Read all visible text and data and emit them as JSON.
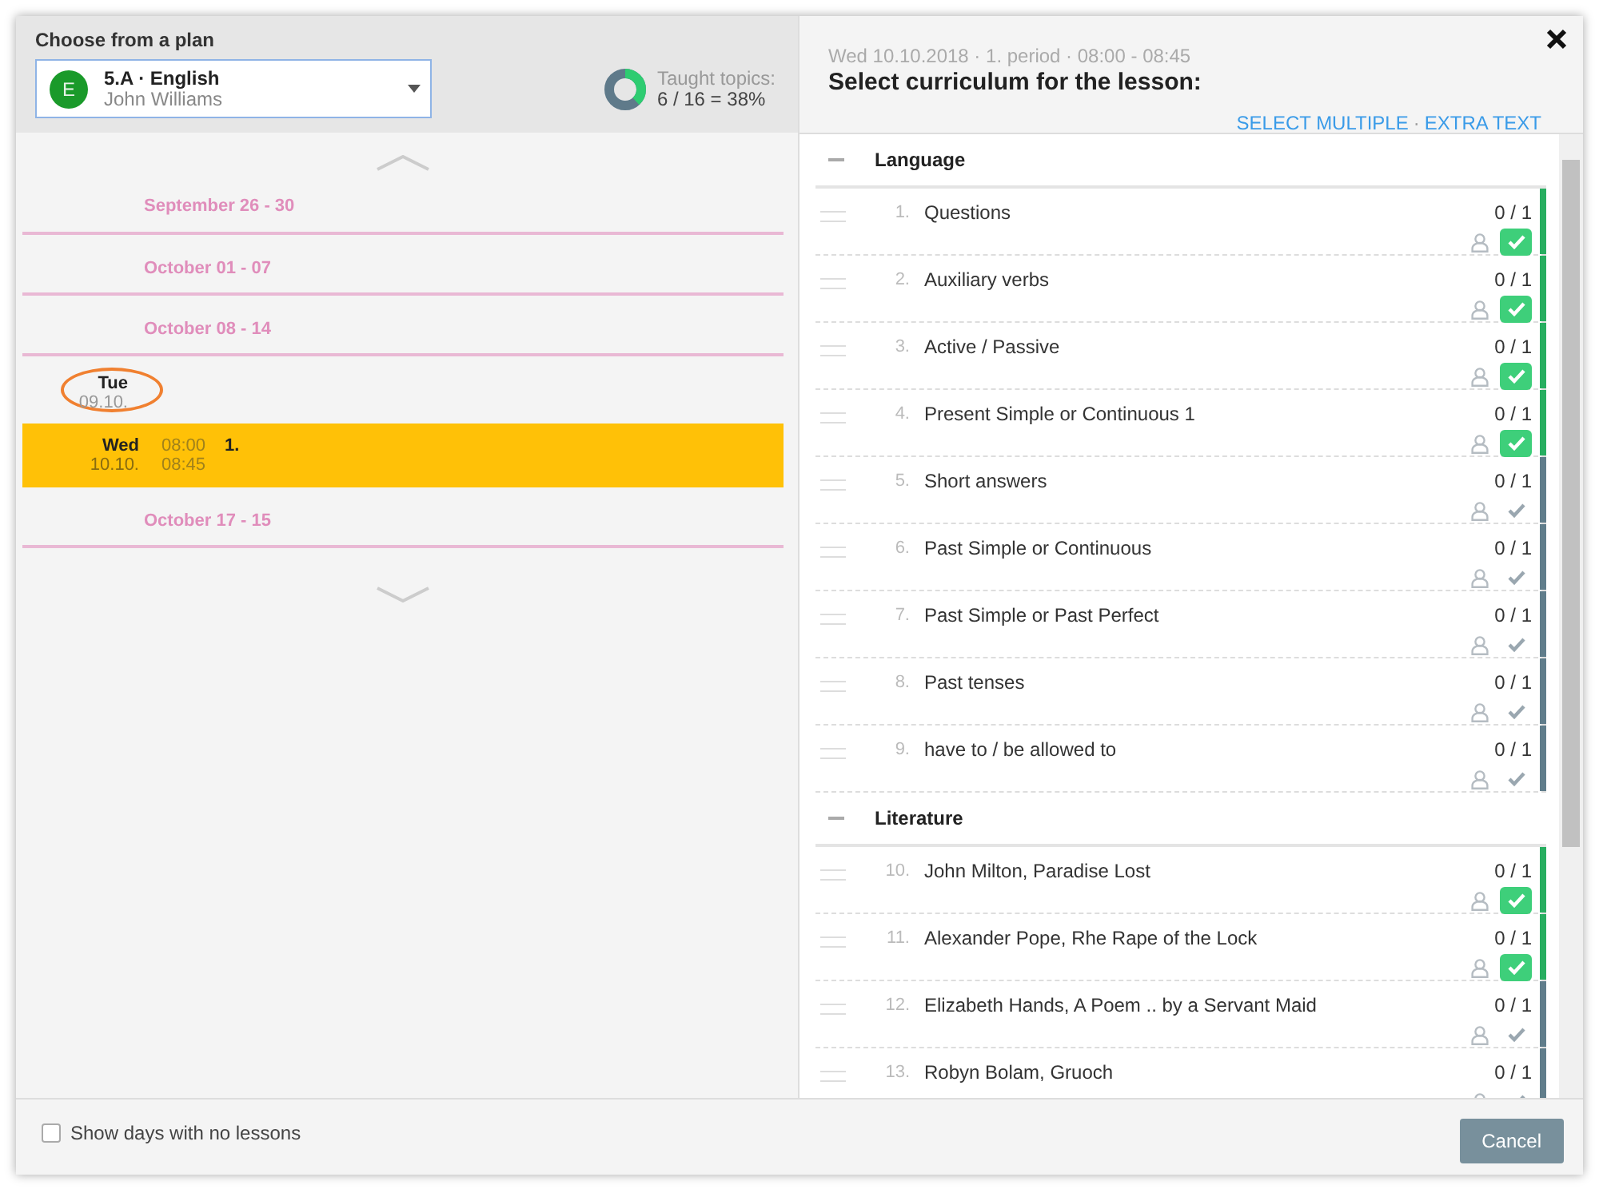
{
  "plan": {
    "heading": "Choose from a plan",
    "badge": "E",
    "title": "5.A · English",
    "teacher": "John Williams"
  },
  "taught": {
    "label": "Taught topics:",
    "value": "6 / 16 = 38%",
    "level": 0.38
  },
  "calendar": [
    {
      "kind": "week",
      "label": "September 26 - 30"
    },
    {
      "kind": "week",
      "label": "October 01 - 07"
    },
    {
      "kind": "week",
      "label": "October 08 - 14"
    },
    {
      "kind": "day",
      "day": "Tue",
      "date": "09.10.",
      "circled": true
    },
    {
      "kind": "lesson",
      "day": "Wed",
      "date": "10.10.",
      "start": "08:00",
      "end": "08:45",
      "period": "1.",
      "selected": true
    },
    {
      "kind": "week",
      "label": "October 17 - 15"
    }
  ],
  "lesson": {
    "subtitle": "Wed 10.10.2018 · 1. period · 08:00 - 08:45",
    "title": "Select curriculum for the lesson:"
  },
  "links": {
    "items": [
      "SELECT MULTIPLE",
      "EXTRA TEXT"
    ],
    "separator": "·"
  },
  "sections": [
    {
      "title": "Language",
      "expanded": true,
      "topics": [
        {
          "number": "1.",
          "name": "Questions",
          "count": "0 / 1",
          "checked": true
        },
        {
          "number": "2.",
          "name": "Auxiliary verbs",
          "count": "0 / 1",
          "checked": true
        },
        {
          "number": "3.",
          "name": "Active / Passive",
          "count": "0 / 1",
          "checked": true
        },
        {
          "number": "4.",
          "name": "Present Simple or Continuous 1",
          "count": "0 / 1",
          "checked": true
        },
        {
          "number": "5.",
          "name": "Short answers",
          "count": "0 / 1",
          "checked": false
        },
        {
          "number": "6.",
          "name": "Past Simple or Continuous",
          "count": "0 / 1",
          "checked": false
        },
        {
          "number": "7.",
          "name": "Past Simple or Past Perfect",
          "count": "0 / 1",
          "checked": false
        },
        {
          "number": "8.",
          "name": "Past tenses",
          "count": "0 / 1",
          "checked": false
        },
        {
          "number": "9.",
          "name": "have to / be allowed to",
          "count": "0 / 1",
          "checked": false
        }
      ]
    },
    {
      "title": "Literature",
      "expanded": true,
      "topics": [
        {
          "number": "10.",
          "name": "John Milton, Paradise Lost",
          "count": "0 / 1",
          "checked": true
        },
        {
          "number": "11.",
          "name": "Alexander Pope, Rhe Rape of the Lock",
          "count": "0 / 1",
          "checked": true
        },
        {
          "number": "12.",
          "name": "Elizabeth Hands, A Poem .. by a Servant Maid",
          "count": "0 / 1",
          "checked": false
        },
        {
          "number": "13.",
          "name": "Robyn Bolam, Gruoch",
          "count": "0 / 1",
          "checked": false
        }
      ]
    }
  ],
  "footer": {
    "checkbox": {
      "label": "Show days with no lessons",
      "checked": false
    },
    "cancel": "Cancel"
  }
}
